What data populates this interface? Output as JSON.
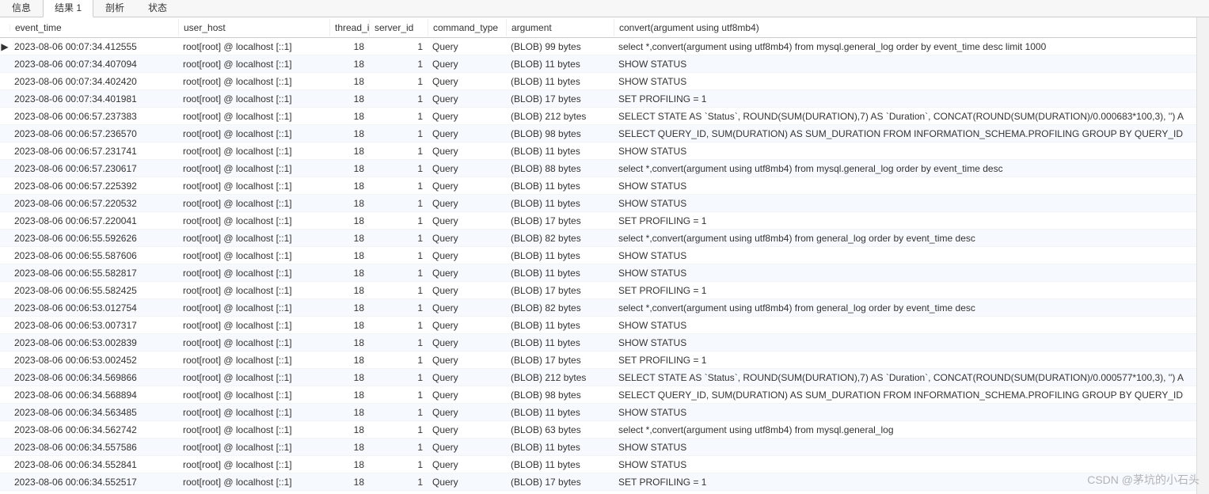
{
  "tabs": [
    "信息",
    "结果 1",
    "剖析",
    "状态"
  ],
  "active_tab_index": 1,
  "columns": [
    "event_time",
    "user_host",
    "thread_i",
    "server_id",
    "command_type",
    "argument",
    "convert(argument using utf8mb4)"
  ],
  "rows": [
    {
      "sel": "▶",
      "event_time": "2023-08-06 00:07:34.412555",
      "user_host": "root[root] @ localhost [::1]",
      "thread": "18",
      "server": "1",
      "cmd": "Query",
      "arg": "(BLOB) 99 bytes",
      "conv": "select *,convert(argument using utf8mb4) from mysql.general_log order by event_time desc limit 1000"
    },
    {
      "sel": "",
      "event_time": "2023-08-06 00:07:34.407094",
      "user_host": "root[root] @ localhost [::1]",
      "thread": "18",
      "server": "1",
      "cmd": "Query",
      "arg": "(BLOB) 11 bytes",
      "conv": "SHOW STATUS"
    },
    {
      "sel": "",
      "event_time": "2023-08-06 00:07:34.402420",
      "user_host": "root[root] @ localhost [::1]",
      "thread": "18",
      "server": "1",
      "cmd": "Query",
      "arg": "(BLOB) 11 bytes",
      "conv": "SHOW STATUS"
    },
    {
      "sel": "",
      "event_time": "2023-08-06 00:07:34.401981",
      "user_host": "root[root] @ localhost [::1]",
      "thread": "18",
      "server": "1",
      "cmd": "Query",
      "arg": "(BLOB) 17 bytes",
      "conv": "SET PROFILING = 1"
    },
    {
      "sel": "",
      "event_time": "2023-08-06 00:06:57.237383",
      "user_host": "root[root] @ localhost [::1]",
      "thread": "18",
      "server": "1",
      "cmd": "Query",
      "arg": "(BLOB) 212 bytes",
      "conv": "SELECT STATE AS `Status`, ROUND(SUM(DURATION),7) AS `Duration`, CONCAT(ROUND(SUM(DURATION)/0.000683*100,3), '') A"
    },
    {
      "sel": "",
      "event_time": "2023-08-06 00:06:57.236570",
      "user_host": "root[root] @ localhost [::1]",
      "thread": "18",
      "server": "1",
      "cmd": "Query",
      "arg": "(BLOB) 98 bytes",
      "conv": "SELECT QUERY_ID, SUM(DURATION) AS SUM_DURATION FROM INFORMATION_SCHEMA.PROFILING GROUP BY QUERY_ID"
    },
    {
      "sel": "",
      "event_time": "2023-08-06 00:06:57.231741",
      "user_host": "root[root] @ localhost [::1]",
      "thread": "18",
      "server": "1",
      "cmd": "Query",
      "arg": "(BLOB) 11 bytes",
      "conv": "SHOW STATUS"
    },
    {
      "sel": "",
      "event_time": "2023-08-06 00:06:57.230617",
      "user_host": "root[root] @ localhost [::1]",
      "thread": "18",
      "server": "1",
      "cmd": "Query",
      "arg": "(BLOB) 88 bytes",
      "conv": "select *,convert(argument using utf8mb4) from mysql.general_log order by event_time desc"
    },
    {
      "sel": "",
      "event_time": "2023-08-06 00:06:57.225392",
      "user_host": "root[root] @ localhost [::1]",
      "thread": "18",
      "server": "1",
      "cmd": "Query",
      "arg": "(BLOB) 11 bytes",
      "conv": "SHOW STATUS"
    },
    {
      "sel": "",
      "event_time": "2023-08-06 00:06:57.220532",
      "user_host": "root[root] @ localhost [::1]",
      "thread": "18",
      "server": "1",
      "cmd": "Query",
      "arg": "(BLOB) 11 bytes",
      "conv": "SHOW STATUS"
    },
    {
      "sel": "",
      "event_time": "2023-08-06 00:06:57.220041",
      "user_host": "root[root] @ localhost [::1]",
      "thread": "18",
      "server": "1",
      "cmd": "Query",
      "arg": "(BLOB) 17 bytes",
      "conv": "SET PROFILING = 1"
    },
    {
      "sel": "",
      "event_time": "2023-08-06 00:06:55.592626",
      "user_host": "root[root] @ localhost [::1]",
      "thread": "18",
      "server": "1",
      "cmd": "Query",
      "arg": "(BLOB) 82 bytes",
      "conv": "select *,convert(argument using utf8mb4) from general_log order by event_time desc"
    },
    {
      "sel": "",
      "event_time": "2023-08-06 00:06:55.587606",
      "user_host": "root[root] @ localhost [::1]",
      "thread": "18",
      "server": "1",
      "cmd": "Query",
      "arg": "(BLOB) 11 bytes",
      "conv": "SHOW STATUS"
    },
    {
      "sel": "",
      "event_time": "2023-08-06 00:06:55.582817",
      "user_host": "root[root] @ localhost [::1]",
      "thread": "18",
      "server": "1",
      "cmd": "Query",
      "arg": "(BLOB) 11 bytes",
      "conv": "SHOW STATUS"
    },
    {
      "sel": "",
      "event_time": "2023-08-06 00:06:55.582425",
      "user_host": "root[root] @ localhost [::1]",
      "thread": "18",
      "server": "1",
      "cmd": "Query",
      "arg": "(BLOB) 17 bytes",
      "conv": "SET PROFILING = 1"
    },
    {
      "sel": "",
      "event_time": "2023-08-06 00:06:53.012754",
      "user_host": "root[root] @ localhost [::1]",
      "thread": "18",
      "server": "1",
      "cmd": "Query",
      "arg": "(BLOB) 82 bytes",
      "conv": "select *,convert(argument using utf8mb4) from general_log order by event_time desc"
    },
    {
      "sel": "",
      "event_time": "2023-08-06 00:06:53.007317",
      "user_host": "root[root] @ localhost [::1]",
      "thread": "18",
      "server": "1",
      "cmd": "Query",
      "arg": "(BLOB) 11 bytes",
      "conv": "SHOW STATUS"
    },
    {
      "sel": "",
      "event_time": "2023-08-06 00:06:53.002839",
      "user_host": "root[root] @ localhost [::1]",
      "thread": "18",
      "server": "1",
      "cmd": "Query",
      "arg": "(BLOB) 11 bytes",
      "conv": "SHOW STATUS"
    },
    {
      "sel": "",
      "event_time": "2023-08-06 00:06:53.002452",
      "user_host": "root[root] @ localhost [::1]",
      "thread": "18",
      "server": "1",
      "cmd": "Query",
      "arg": "(BLOB) 17 bytes",
      "conv": "SET PROFILING = 1"
    },
    {
      "sel": "",
      "event_time": "2023-08-06 00:06:34.569866",
      "user_host": "root[root] @ localhost [::1]",
      "thread": "18",
      "server": "1",
      "cmd": "Query",
      "arg": "(BLOB) 212 bytes",
      "conv": "SELECT STATE AS `Status`, ROUND(SUM(DURATION),7) AS `Duration`, CONCAT(ROUND(SUM(DURATION)/0.000577*100,3), '') A"
    },
    {
      "sel": "",
      "event_time": "2023-08-06 00:06:34.568894",
      "user_host": "root[root] @ localhost [::1]",
      "thread": "18",
      "server": "1",
      "cmd": "Query",
      "arg": "(BLOB) 98 bytes",
      "conv": "SELECT QUERY_ID, SUM(DURATION) AS SUM_DURATION FROM INFORMATION_SCHEMA.PROFILING GROUP BY QUERY_ID"
    },
    {
      "sel": "",
      "event_time": "2023-08-06 00:06:34.563485",
      "user_host": "root[root] @ localhost [::1]",
      "thread": "18",
      "server": "1",
      "cmd": "Query",
      "arg": "(BLOB) 11 bytes",
      "conv": "SHOW STATUS"
    },
    {
      "sel": "",
      "event_time": "2023-08-06 00:06:34.562742",
      "user_host": "root[root] @ localhost [::1]",
      "thread": "18",
      "server": "1",
      "cmd": "Query",
      "arg": "(BLOB) 63 bytes",
      "conv": "select *,convert(argument using utf8mb4) from mysql.general_log"
    },
    {
      "sel": "",
      "event_time": "2023-08-06 00:06:34.557586",
      "user_host": "root[root] @ localhost [::1]",
      "thread": "18",
      "server": "1",
      "cmd": "Query",
      "arg": "(BLOB) 11 bytes",
      "conv": "SHOW STATUS"
    },
    {
      "sel": "",
      "event_time": "2023-08-06 00:06:34.552841",
      "user_host": "root[root] @ localhost [::1]",
      "thread": "18",
      "server": "1",
      "cmd": "Query",
      "arg": "(BLOB) 11 bytes",
      "conv": "SHOW STATUS"
    },
    {
      "sel": "",
      "event_time": "2023-08-06 00:06:34.552517",
      "user_host": "root[root] @ localhost [::1]",
      "thread": "18",
      "server": "1",
      "cmd": "Query",
      "arg": "(BLOB) 17 bytes",
      "conv": "SET PROFILING = 1"
    }
  ],
  "watermark": "CSDN @茅坑的小石头"
}
